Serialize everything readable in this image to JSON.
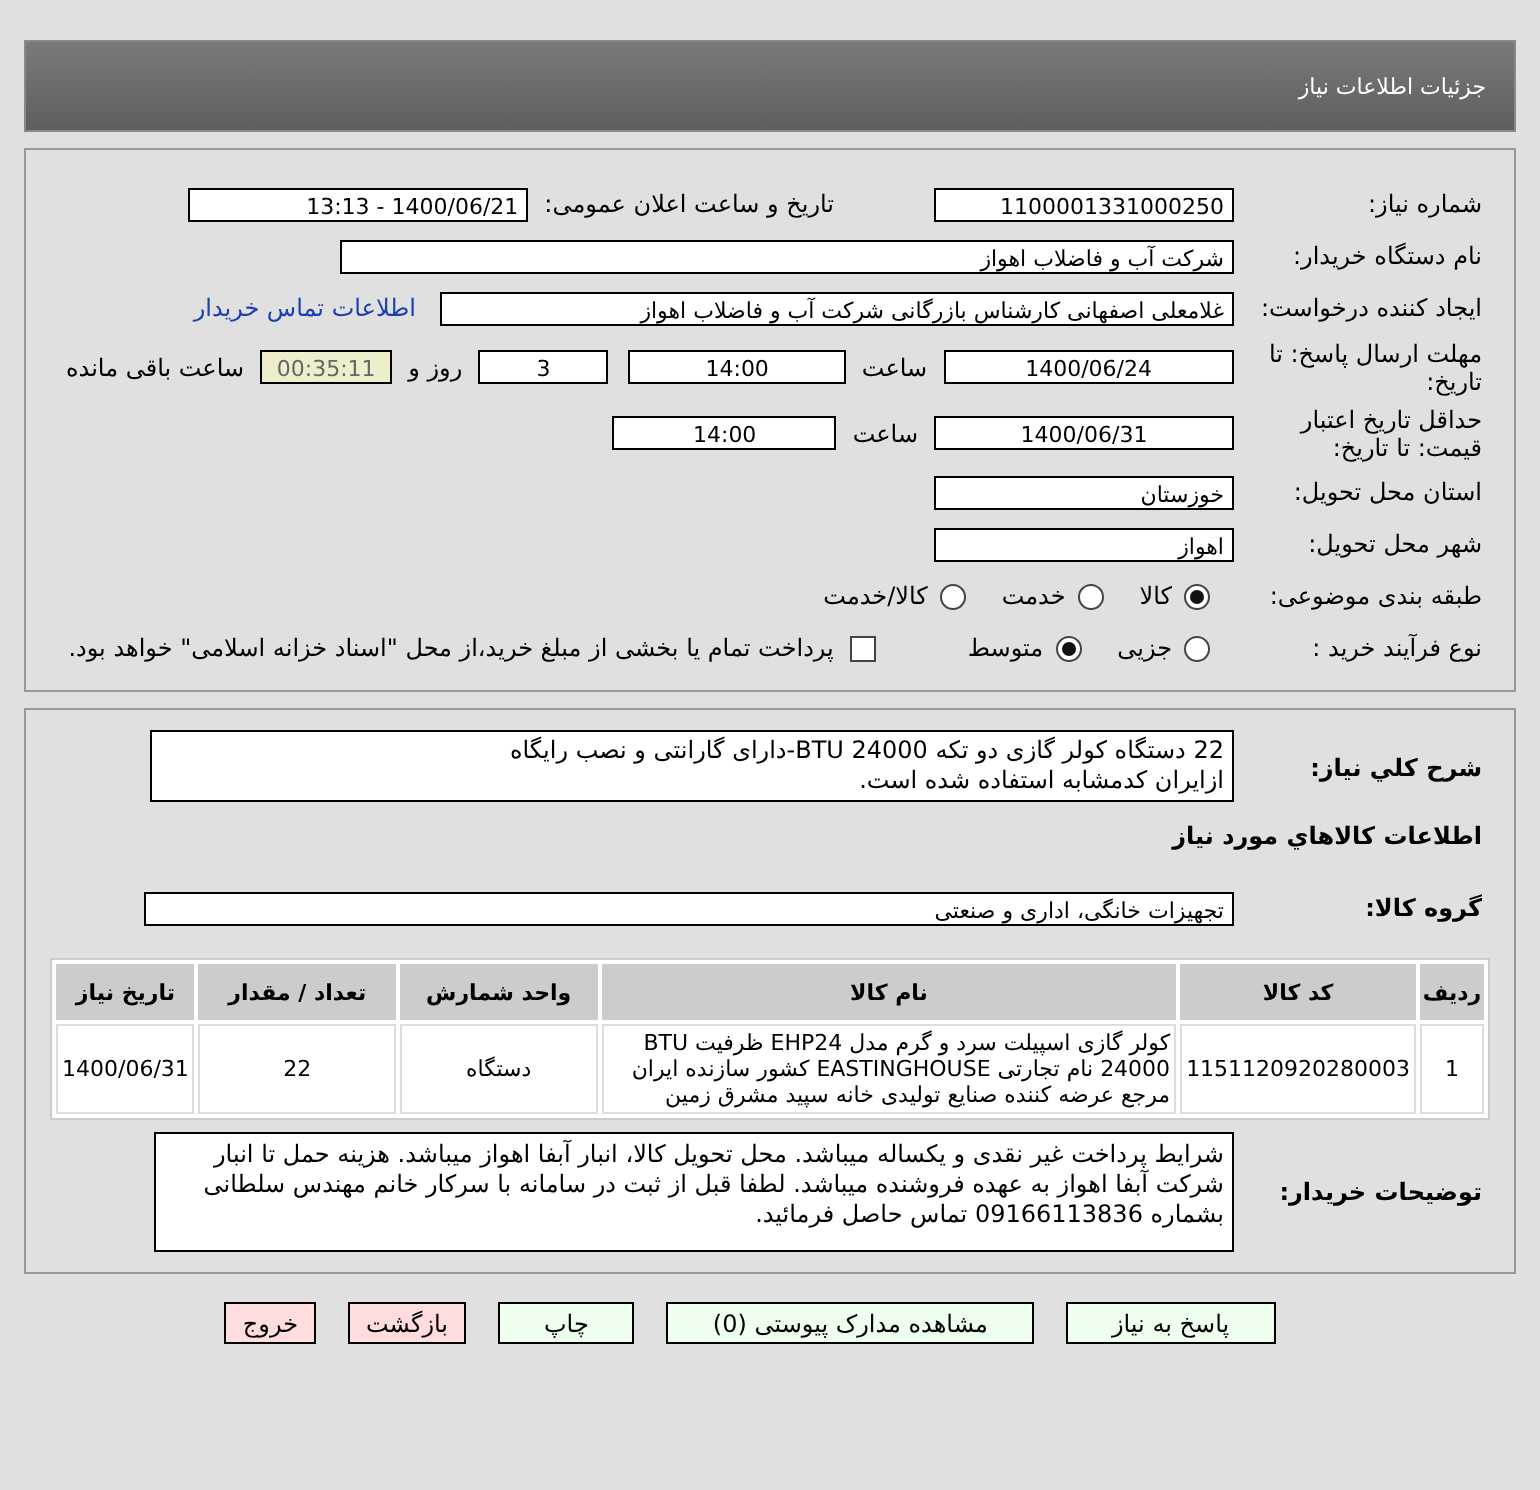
{
  "header": {
    "title": "جزئیات اطلاعات نیاز"
  },
  "need_number": {
    "label": "شماره نیاز:",
    "value": "1100001331000250"
  },
  "announce": {
    "label": "تاریخ و ساعت اعلان عمومی:",
    "value": "1400/06/21 - 13:13"
  },
  "buyer": {
    "label": "نام دستگاه خریدار:",
    "value": "شرکت آب و فاضلاب اهواز"
  },
  "requester": {
    "label": "ایجاد کننده درخواست:",
    "value": "غلامعلی اصفهانی کارشناس بازرگانی شرکت آب و فاضلاب اهواز",
    "link": "اطلاعات تماس خریدار"
  },
  "deadline": {
    "label": "مهلت ارسال پاسخ: تا تاریخ:",
    "date": "1400/06/24",
    "time_label": "ساعت",
    "time": "14:00",
    "days": "3",
    "days_label": "روز و",
    "remaining": "00:35:11",
    "remaining_label": "ساعت باقی مانده"
  },
  "validity": {
    "label": "حداقل تاریخ اعتبار قیمت: تا تاریخ:",
    "date": "1400/06/31",
    "time_label": "ساعت",
    "time": "14:00"
  },
  "province": {
    "label": "استان محل تحویل:",
    "value": "خوزستان"
  },
  "city": {
    "label": "شهر محل تحویل:",
    "value": "اهواز"
  },
  "category": {
    "label": "طبقه بندی موضوعی:",
    "options": [
      {
        "label": "کالا",
        "selected": true
      },
      {
        "label": "خدمت",
        "selected": false
      },
      {
        "label": "کالا/خدمت",
        "selected": false
      }
    ]
  },
  "process": {
    "label": "نوع فرآیند خرید :",
    "options": [
      {
        "label": "جزیی",
        "selected": false
      },
      {
        "label": "متوسط",
        "selected": true
      }
    ],
    "payment": {
      "label": "پرداخت تمام یا بخشی از مبلغ خرید،از محل \"اسناد خزانه اسلامی\" خواهد بود.",
      "checked": false
    }
  },
  "description": {
    "label": "شرح كلي نياز:",
    "lines": [
      "22 دستگاه کولر گازی دو تکه BTU 24000-دارای گارانتی و نصب رایگاه",
      "ازایران کدمشابه استفاده شده است."
    ]
  },
  "goods_heading": "اطلاعات كالاهاي مورد نياز",
  "goods_group": {
    "label": "گروه كالا:",
    "value": "تجهیزات خانگی، اداری و صنعتی"
  },
  "table": {
    "columns": [
      "ردیف",
      "کد کالا",
      "نام کالا",
      "واحد شمارش",
      "تعداد / مقدار",
      "تاریخ نیاز"
    ],
    "rows": [
      {
        "cells": [
          "1",
          "1151120920280003",
          "کولر گازی اسپیلت سرد و گرم مدل EHP24 ظرفیت BTU 24000 نام تجارتی EASTINGHOUSE کشور سازنده ایران مرجع عرضه کننده صنایع تولیدی خانه سپید مشرق زمین",
          "دستگاه",
          "22",
          "1400/06/31"
        ]
      }
    ]
  },
  "buyer_notes": {
    "label": "توضیحات خریدار:",
    "text": "شرایط پرداخت غیر نقدی و یکساله میباشد. محل تحویل کالا، انبار آبفا اهواز میباشد. هزینه حمل تا انبار شرکت آبفا اهواز به عهده فروشنده میباشد. لطفا قبل از ثبت در سامانه با سرکار خانم مهندس سلطانی بشماره 09166113836 تماس حاصل فرمائید."
  },
  "buttons": [
    {
      "label": "پاسخ به نیاز",
      "kind": "normal"
    },
    {
      "label": "مشاهده مدارک پیوستی (0)",
      "kind": "normal"
    },
    {
      "label": "چاپ",
      "kind": "normal"
    },
    {
      "label": "بازگشت",
      "kind": "danger"
    },
    {
      "label": "خروج",
      "kind": "danger"
    }
  ]
}
